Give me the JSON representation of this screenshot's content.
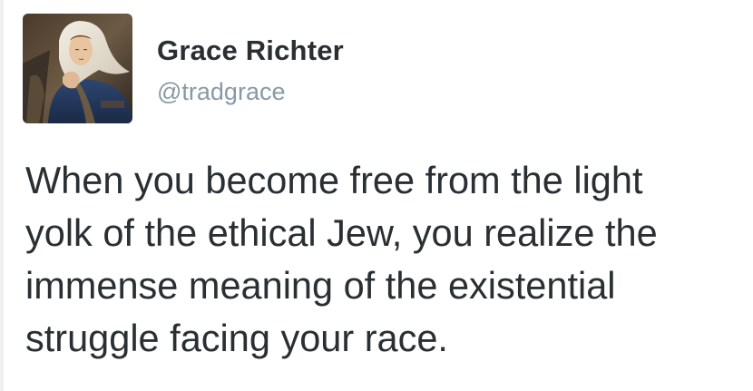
{
  "tweet": {
    "author": {
      "display_name": "Grace Richter",
      "handle": "@tradgrace",
      "avatar_icon": "painted-portrait-avatar"
    },
    "text_lines": [
      "When you become free from the light",
      "yolk of the ethical Jew, you realize the",
      "immense meaning of the existential",
      "struggle facing your race."
    ],
    "colors": {
      "name": "#292f33",
      "handle": "#8899a6",
      "text": "#292f33",
      "background": "#ffffff"
    }
  }
}
